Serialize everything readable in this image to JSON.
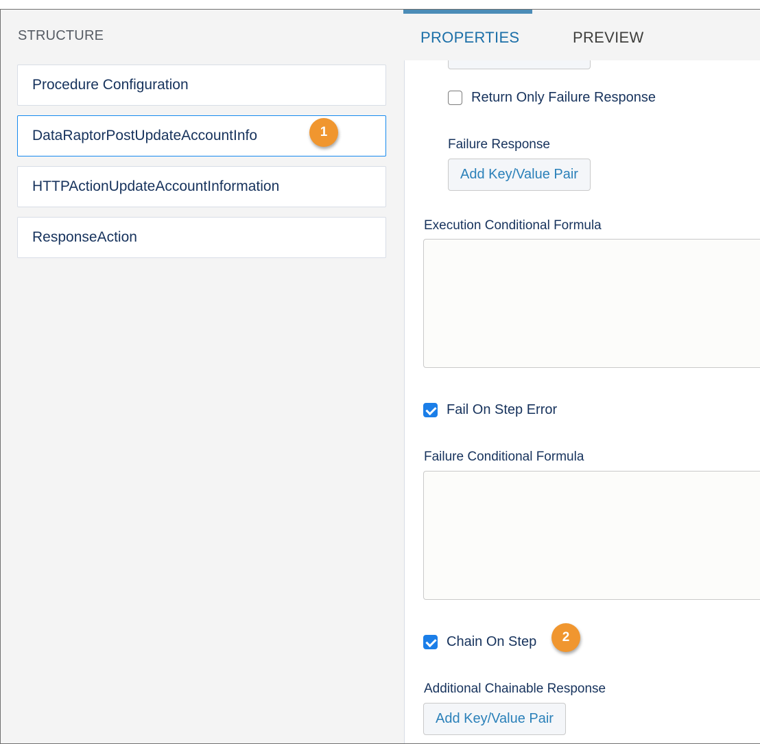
{
  "structure": {
    "title": "STRUCTURE",
    "items": [
      {
        "label": "Procedure Configuration"
      },
      {
        "label": "DataRaptorPostUpdateAccountInfo"
      },
      {
        "label": "HTTPActionUpdateAccountInformation"
      },
      {
        "label": "ResponseAction"
      }
    ],
    "selected_index": 1
  },
  "tabs": {
    "properties": "PROPERTIES",
    "preview": "PREVIEW",
    "active": "properties"
  },
  "callouts": {
    "one": "1",
    "two": "2"
  },
  "properties": {
    "return_only_failure": {
      "label": "Return Only Failure Response",
      "checked": false
    },
    "failure_response": {
      "label": "Failure Response",
      "button": "Add Key/Value Pair"
    },
    "execution_formula": {
      "label": "Execution Conditional Formula",
      "value": ""
    },
    "fail_on_step_error": {
      "label": "Fail On Step Error",
      "checked": true
    },
    "failure_formula": {
      "label": "Failure Conditional Formula",
      "value": ""
    },
    "chain_on_step": {
      "label": "Chain On Step",
      "checked": true
    },
    "additional_chainable": {
      "label": "Additional Chainable Response",
      "button": "Add Key/Value Pair"
    }
  },
  "colors": {
    "accent": "#1589ee",
    "tab_active": "#1b6fa8",
    "callout": "#f0962f",
    "checkbox_checked": "#1b7ee8"
  }
}
